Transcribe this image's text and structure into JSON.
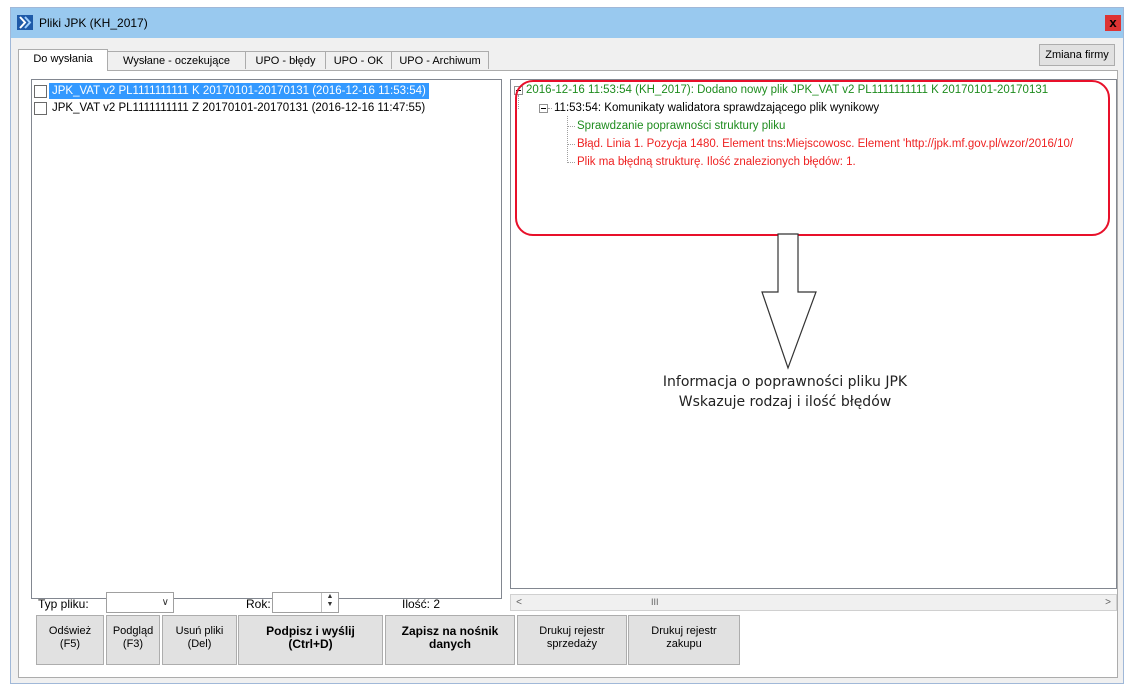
{
  "window": {
    "title": "Pliki JPK (KH_2017)",
    "close_label": "x"
  },
  "tabs": [
    {
      "label": "Do wysłania",
      "active": true
    },
    {
      "label": "Wysłane - oczekujące",
      "active": false
    },
    {
      "label": "UPO - błędy",
      "active": false
    },
    {
      "label": "UPO - OK",
      "active": false
    },
    {
      "label": "UPO - Archiwum",
      "active": false
    }
  ],
  "firm_button": "Zmiana firmy",
  "files": [
    {
      "label": "JPK_VAT v2  PL1111111111 K 20170101-20170131 (2016-12-16 11:53:54)",
      "selected": true,
      "checked": false
    },
    {
      "label": "JPK_VAT v2  PL1111111111 Z 20170101-20170131 (2016-12-16 11:47:55)",
      "selected": false,
      "checked": false
    }
  ],
  "tree": {
    "root": "2016-12-16 11:53:54 (KH_2017): Dodano nowy plik JPK_VAT v2  PL1111111111 K 20170101-20170131",
    "child": "11:53:54: Komunikaty walidatora sprawdzającego plik wynikowy",
    "leaves": [
      {
        "text": "Sprawdzanie poprawności struktury pliku",
        "status": "ok"
      },
      {
        "text": "Błąd. Linia 1. Pozycja 1480. Element tns:Miejscowosc. Element 'http://jpk.mf.gov.pl/wzor/2016/10/",
        "status": "error"
      },
      {
        "text": "Plik ma błędną strukturę. Ilość znalezionych błędów: 1.",
        "status": "error"
      }
    ]
  },
  "scroll": {
    "left": "<",
    "right": ">",
    "thumb": "III"
  },
  "annotation": {
    "line1": "Informacja o poprawności pliku JPK",
    "line2": "Wskazuje rodzaj i ilość błędów"
  },
  "filters": {
    "type_label": "Typ pliku:",
    "type_value": "",
    "year_label": "Rok:",
    "year_value": "",
    "count_label": "Ilość: 2"
  },
  "buttons": [
    {
      "line1": "Odśwież",
      "line2": "(F5)"
    },
    {
      "line1": "Podgląd",
      "line2": "(F3)"
    },
    {
      "line1": "Usuń pliki",
      "line2": "(Del)"
    },
    {
      "line1": "Podpisz i wyślij",
      "line2": "(Ctrl+D)"
    },
    {
      "line1": "Zapisz na nośnik",
      "line2": "danych"
    },
    {
      "line1": "Drukuj rejestr",
      "line2": "sprzedaży"
    },
    {
      "line1": "Drukuj rejestr",
      "line2": "zakupu"
    }
  ],
  "colors": {
    "ok": "#1e8c1e",
    "error": "#ee2222",
    "annotation_border": "#e8102a",
    "selection": "#3399ff",
    "titlebar": "#99c9ef"
  }
}
